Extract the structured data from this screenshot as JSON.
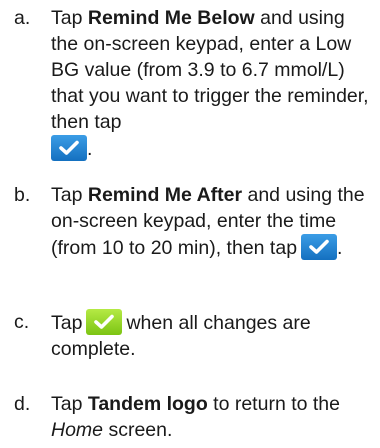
{
  "steps": [
    {
      "marker": "a.",
      "t1": "Tap ",
      "b1": "Remind Me Below",
      "t2": " and using the on-screen keypad, enter a Low BG value (from 3.9 to 6.7 mmol/L) that you want to trigger the reminder, then tap",
      "t3": ".",
      "button": {
        "icon": "checkmark-icon",
        "color": "#1f7fd1"
      }
    },
    {
      "marker": "b.",
      "t1": "Tap ",
      "b1": "Remind Me After",
      "t2": " and using the on-screen keypad, enter the time (from 10 to 20 min), then tap",
      "t3": ".",
      "button": {
        "icon": "checkmark-icon",
        "color": "#1f7fd1"
      }
    },
    {
      "marker": "c.",
      "t1": "Tap",
      "t2": "when all changes are complete.",
      "button": {
        "icon": "checkmark-icon",
        "color": "#8fd11f"
      }
    },
    {
      "marker": "d.",
      "t1": "Tap ",
      "b1": "Tandem logo",
      "t2": " to return to the ",
      "i1": "Home",
      "t3": " screen."
    }
  ]
}
